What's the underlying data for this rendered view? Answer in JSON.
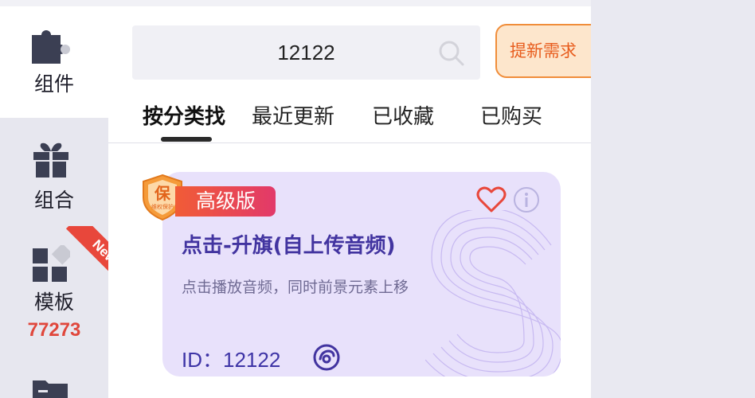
{
  "sidebar": {
    "items": [
      {
        "label": "组件",
        "icon": "puzzle-icon",
        "active": true
      },
      {
        "label": "组合",
        "icon": "gift-icon",
        "active": false
      },
      {
        "label": "模板",
        "icon": "grid-icon",
        "count": "77273",
        "badge": "New",
        "active": false
      },
      {
        "label": "",
        "icon": "folder-icon",
        "active": false
      }
    ]
  },
  "search": {
    "value": "12122",
    "icon": "search-icon"
  },
  "header": {
    "request_button": "提新需求"
  },
  "tabs": [
    {
      "label": "按分类找",
      "active": true
    },
    {
      "label": "最近更新",
      "active": false
    },
    {
      "label": "已收藏",
      "active": false
    },
    {
      "label": "已购买",
      "active": false
    }
  ],
  "card": {
    "badge_label": "高级版",
    "shield_char": "保",
    "shield_text": "维权保护",
    "title": "点击-升旗(自上传音频)",
    "description": "点击播放音频，同时前景元素上移",
    "id_text": "ID：12122",
    "icons": [
      "heart-icon",
      "info-icon",
      "audio-icon"
    ]
  },
  "colors": {
    "accent_orange": "#f08d3a",
    "badge_gradient_start": "#f15c36",
    "badge_gradient_end": "#e2396a",
    "card_bg": "#e8e1fb",
    "card_title": "#4234a0",
    "count_red": "#e0473c"
  }
}
